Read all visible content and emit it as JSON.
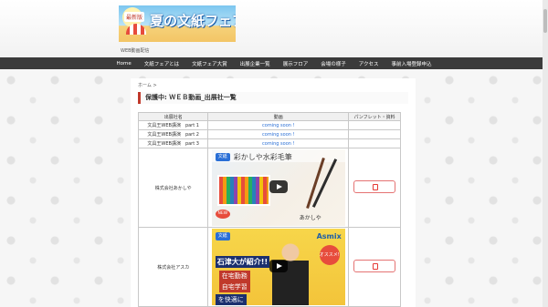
{
  "site": {
    "banner_tag": "最新版",
    "banner_title": "夏の文紙フェア",
    "description": "WEB動画配信"
  },
  "nav": {
    "items": [
      "Home",
      "文紙フェアとは",
      "文紙フェア大賞",
      "出展企業一覧",
      "展示フロア",
      "会場の様子",
      "アクセス",
      "事前入場登録申込"
    ]
  },
  "breadcrumb": "ホーム >",
  "page_title": "保護中: ＷＥＢ動画_出展社一覧",
  "table": {
    "headers": [
      "出展社名",
      "動画",
      "パンフレット・資料"
    ],
    "text_rows": [
      {
        "name": "文具王WEB講演　part 1",
        "video": "coming soon !"
      },
      {
        "name": "文具王WEB講演　part 2",
        "video": "coming soon !"
      },
      {
        "name": "文具王WEB講演　part 3",
        "video": "coming soon !"
      }
    ],
    "video_rows": [
      {
        "name": "株式会社あかしや",
        "thumb": {
          "logo": "文紙",
          "headline": "彩かしや水彩毛筆",
          "new_badge": "NEW",
          "brand": "あかしや"
        }
      },
      {
        "name": "株式会社アスカ",
        "thumb": {
          "logo": "文紙",
          "brand": "Asmix",
          "name_line": "石津大が紹介!!",
          "line1": "在宅勤務",
          "line2": "自宅学習",
          "line3": "を快適に",
          "badge": "オススメ!"
        }
      }
    ]
  },
  "colors": {
    "nav_bg": "#3b3b3b",
    "accent_red": "#c0392b",
    "link_blue": "#2a6fd6"
  }
}
